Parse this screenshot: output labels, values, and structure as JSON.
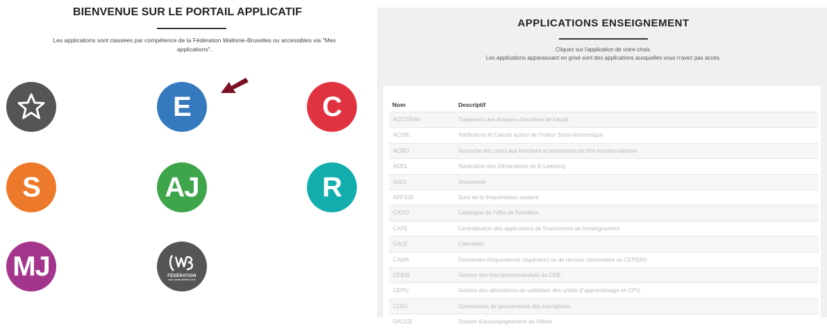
{
  "left": {
    "title": "BIENVENUE SUR LE PORTAIL APPLICATIF",
    "description": "Les applications sont classées par compétence de la Fédération Wallonie-Bruxelles ou accessibles via \"Mes applications\".",
    "tiles": [
      {
        "id": "favorites",
        "label": "",
        "icon": "star-icon",
        "color": "#555555"
      },
      {
        "id": "e",
        "label": "E",
        "icon": "",
        "color": "#3579bf"
      },
      {
        "id": "c",
        "label": "C",
        "icon": "",
        "color": "#e0323f"
      },
      {
        "id": "s",
        "label": "S",
        "icon": "",
        "color": "#ed7a2a"
      },
      {
        "id": "aj",
        "label": "AJ",
        "icon": "",
        "color": "#3ea54a"
      },
      {
        "id": "r",
        "label": "R",
        "icon": "",
        "color": "#12aeae"
      },
      {
        "id": "mj",
        "label": "MJ",
        "icon": "",
        "color": "#a4358c"
      },
      {
        "id": "fwb",
        "label": "",
        "icon": "federation-logo",
        "logo_text": "FÉDÉRATION",
        "logo_subtext": "WALLONIE-BRUXELLES",
        "color": "#555555"
      }
    ],
    "arrow_color": "#7a1020"
  },
  "right": {
    "title": "APPLICATIONS  ENSEIGNEMENT",
    "desc_line1": "Cliquez sur l'application de votre choix.",
    "desc_line2": "Les applications apparaissant en grisé sont des applications auxquelles vous n'avez pas accès.",
    "table": {
      "col_name": "Nom",
      "col_desc": "Descriptif",
      "rows": [
        {
          "name": "ACCITRAV",
          "desc": "Traitement des dossiers d'accident de travail."
        },
        {
          "name": "ACISE",
          "desc": "Attributions et Calculs autour de l'Indice Socio-économique"
        },
        {
          "name": "ACRO",
          "desc": "Accroche des cours aux fonctions et association de titre-fonction-barème"
        },
        {
          "name": "ADEL",
          "desc": "Application des Déclarations de E-Learning"
        },
        {
          "name": "ANCI",
          "desc": "Ancienneté"
        },
        {
          "name": "APP100",
          "desc": "Suivi de la fréquentation scolaire"
        },
        {
          "name": "CADO",
          "desc": "Catalogue de l'offre de formation"
        },
        {
          "name": "CAFE",
          "desc": "Centralisation des applications de financement de l'enseignement"
        },
        {
          "name": "CALE",
          "desc": "Calendrier"
        },
        {
          "name": "CAMA",
          "desc": "Demandes d'équivalence (supérieur) ou de recours (secondaire ou CEPERI)"
        },
        {
          "name": "CEBSI",
          "desc": "Gestion des inscriptions/résultats au CEB"
        },
        {
          "name": "CEPU",
          "desc": "Gestion des attestations de validation des unités d''apprentissage en CPU"
        },
        {
          "name": "COGI",
          "desc": "Commission de gouvernance des inscriptions"
        },
        {
          "name": "DACCE",
          "desc": "Dossier d'accompagnement de l'élève"
        }
      ]
    }
  }
}
